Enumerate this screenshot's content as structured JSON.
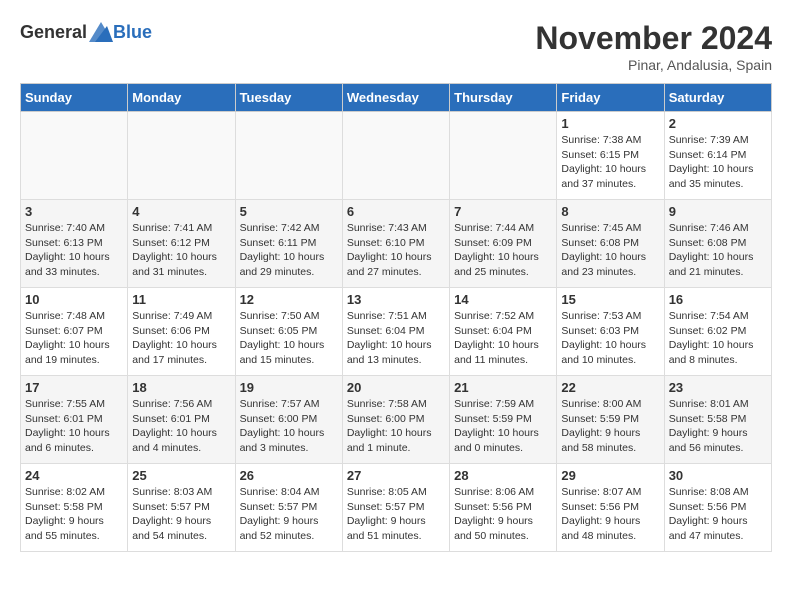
{
  "header": {
    "logo_general": "General",
    "logo_blue": "Blue",
    "month": "November 2024",
    "location": "Pinar, Andalusia, Spain"
  },
  "days_of_week": [
    "Sunday",
    "Monday",
    "Tuesday",
    "Wednesday",
    "Thursday",
    "Friday",
    "Saturday"
  ],
  "weeks": [
    [
      {
        "day": "",
        "empty": true
      },
      {
        "day": "",
        "empty": true
      },
      {
        "day": "",
        "empty": true
      },
      {
        "day": "",
        "empty": true
      },
      {
        "day": "",
        "empty": true
      },
      {
        "day": "1",
        "sunrise": "Sunrise: 7:38 AM",
        "sunset": "Sunset: 6:15 PM",
        "daylight": "Daylight: 10 hours and 37 minutes."
      },
      {
        "day": "2",
        "sunrise": "Sunrise: 7:39 AM",
        "sunset": "Sunset: 6:14 PM",
        "daylight": "Daylight: 10 hours and 35 minutes."
      }
    ],
    [
      {
        "day": "3",
        "sunrise": "Sunrise: 7:40 AM",
        "sunset": "Sunset: 6:13 PM",
        "daylight": "Daylight: 10 hours and 33 minutes."
      },
      {
        "day": "4",
        "sunrise": "Sunrise: 7:41 AM",
        "sunset": "Sunset: 6:12 PM",
        "daylight": "Daylight: 10 hours and 31 minutes."
      },
      {
        "day": "5",
        "sunrise": "Sunrise: 7:42 AM",
        "sunset": "Sunset: 6:11 PM",
        "daylight": "Daylight: 10 hours and 29 minutes."
      },
      {
        "day": "6",
        "sunrise": "Sunrise: 7:43 AM",
        "sunset": "Sunset: 6:10 PM",
        "daylight": "Daylight: 10 hours and 27 minutes."
      },
      {
        "day": "7",
        "sunrise": "Sunrise: 7:44 AM",
        "sunset": "Sunset: 6:09 PM",
        "daylight": "Daylight: 10 hours and 25 minutes."
      },
      {
        "day": "8",
        "sunrise": "Sunrise: 7:45 AM",
        "sunset": "Sunset: 6:08 PM",
        "daylight": "Daylight: 10 hours and 23 minutes."
      },
      {
        "day": "9",
        "sunrise": "Sunrise: 7:46 AM",
        "sunset": "Sunset: 6:08 PM",
        "daylight": "Daylight: 10 hours and 21 minutes."
      }
    ],
    [
      {
        "day": "10",
        "sunrise": "Sunrise: 7:48 AM",
        "sunset": "Sunset: 6:07 PM",
        "daylight": "Daylight: 10 hours and 19 minutes."
      },
      {
        "day": "11",
        "sunrise": "Sunrise: 7:49 AM",
        "sunset": "Sunset: 6:06 PM",
        "daylight": "Daylight: 10 hours and 17 minutes."
      },
      {
        "day": "12",
        "sunrise": "Sunrise: 7:50 AM",
        "sunset": "Sunset: 6:05 PM",
        "daylight": "Daylight: 10 hours and 15 minutes."
      },
      {
        "day": "13",
        "sunrise": "Sunrise: 7:51 AM",
        "sunset": "Sunset: 6:04 PM",
        "daylight": "Daylight: 10 hours and 13 minutes."
      },
      {
        "day": "14",
        "sunrise": "Sunrise: 7:52 AM",
        "sunset": "Sunset: 6:04 PM",
        "daylight": "Daylight: 10 hours and 11 minutes."
      },
      {
        "day": "15",
        "sunrise": "Sunrise: 7:53 AM",
        "sunset": "Sunset: 6:03 PM",
        "daylight": "Daylight: 10 hours and 10 minutes."
      },
      {
        "day": "16",
        "sunrise": "Sunrise: 7:54 AM",
        "sunset": "Sunset: 6:02 PM",
        "daylight": "Daylight: 10 hours and 8 minutes."
      }
    ],
    [
      {
        "day": "17",
        "sunrise": "Sunrise: 7:55 AM",
        "sunset": "Sunset: 6:01 PM",
        "daylight": "Daylight: 10 hours and 6 minutes."
      },
      {
        "day": "18",
        "sunrise": "Sunrise: 7:56 AM",
        "sunset": "Sunset: 6:01 PM",
        "daylight": "Daylight: 10 hours and 4 minutes."
      },
      {
        "day": "19",
        "sunrise": "Sunrise: 7:57 AM",
        "sunset": "Sunset: 6:00 PM",
        "daylight": "Daylight: 10 hours and 3 minutes."
      },
      {
        "day": "20",
        "sunrise": "Sunrise: 7:58 AM",
        "sunset": "Sunset: 6:00 PM",
        "daylight": "Daylight: 10 hours and 1 minute."
      },
      {
        "day": "21",
        "sunrise": "Sunrise: 7:59 AM",
        "sunset": "Sunset: 5:59 PM",
        "daylight": "Daylight: 10 hours and 0 minutes."
      },
      {
        "day": "22",
        "sunrise": "Sunrise: 8:00 AM",
        "sunset": "Sunset: 5:59 PM",
        "daylight": "Daylight: 9 hours and 58 minutes."
      },
      {
        "day": "23",
        "sunrise": "Sunrise: 8:01 AM",
        "sunset": "Sunset: 5:58 PM",
        "daylight": "Daylight: 9 hours and 56 minutes."
      }
    ],
    [
      {
        "day": "24",
        "sunrise": "Sunrise: 8:02 AM",
        "sunset": "Sunset: 5:58 PM",
        "daylight": "Daylight: 9 hours and 55 minutes."
      },
      {
        "day": "25",
        "sunrise": "Sunrise: 8:03 AM",
        "sunset": "Sunset: 5:57 PM",
        "daylight": "Daylight: 9 hours and 54 minutes."
      },
      {
        "day": "26",
        "sunrise": "Sunrise: 8:04 AM",
        "sunset": "Sunset: 5:57 PM",
        "daylight": "Daylight: 9 hours and 52 minutes."
      },
      {
        "day": "27",
        "sunrise": "Sunrise: 8:05 AM",
        "sunset": "Sunset: 5:57 PM",
        "daylight": "Daylight: 9 hours and 51 minutes."
      },
      {
        "day": "28",
        "sunrise": "Sunrise: 8:06 AM",
        "sunset": "Sunset: 5:56 PM",
        "daylight": "Daylight: 9 hours and 50 minutes."
      },
      {
        "day": "29",
        "sunrise": "Sunrise: 8:07 AM",
        "sunset": "Sunset: 5:56 PM",
        "daylight": "Daylight: 9 hours and 48 minutes."
      },
      {
        "day": "30",
        "sunrise": "Sunrise: 8:08 AM",
        "sunset": "Sunset: 5:56 PM",
        "daylight": "Daylight: 9 hours and 47 minutes."
      }
    ]
  ]
}
